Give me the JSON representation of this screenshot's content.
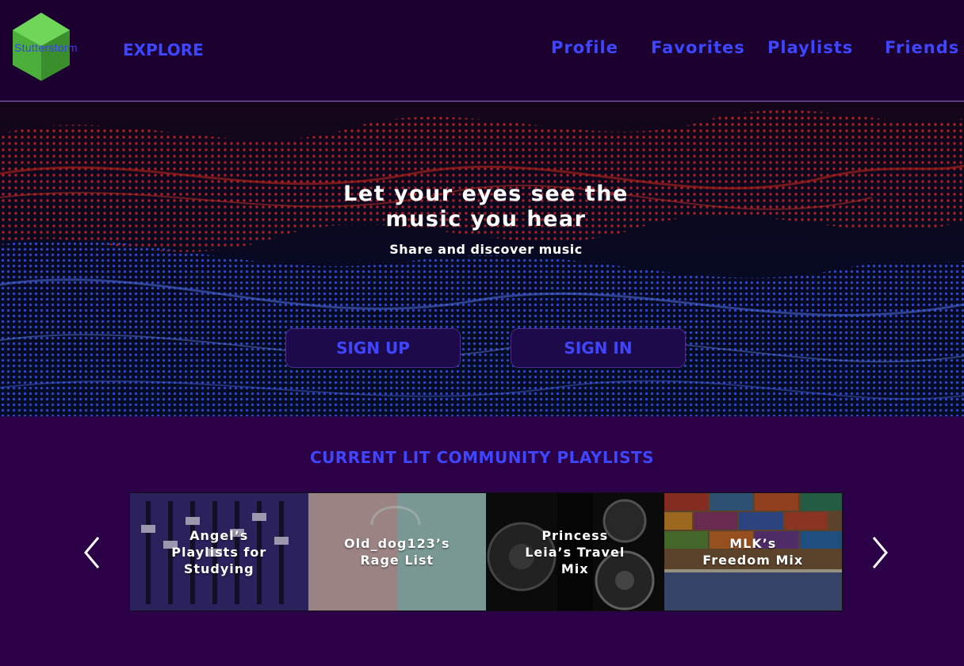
{
  "header": {
    "logo_text": "Stutterstorm",
    "explore_label": "EXPLORE",
    "nav": [
      {
        "label": "Profile"
      },
      {
        "label": "Favorites"
      },
      {
        "label": "Playlists"
      },
      {
        "label": "Friends"
      }
    ]
  },
  "hero": {
    "title": "Let your eyes see the music you hear",
    "subtitle": "Share and discover music",
    "sign_up_label": "SIGN UP",
    "sign_in_label": "SIGN IN"
  },
  "community": {
    "title": "CURRENT LIT COMMUNITY PLAYLISTS",
    "playlists": [
      {
        "title": "Angel’s Playlists for Studying"
      },
      {
        "title": "Old_dog123’s Rage List"
      },
      {
        "title": "Princess Leia’s Travel Mix"
      },
      {
        "title": "MLK’s Freedom Mix"
      }
    ],
    "prev_icon": "chevron-left-icon",
    "next_icon": "chevron-right-icon"
  },
  "colors": {
    "page_bg": "#2c0046",
    "header_bg": "#1b0030",
    "accent": "#3f46ff",
    "button_bg": "#1d0a4a",
    "logo_green": "#4caf3c"
  }
}
